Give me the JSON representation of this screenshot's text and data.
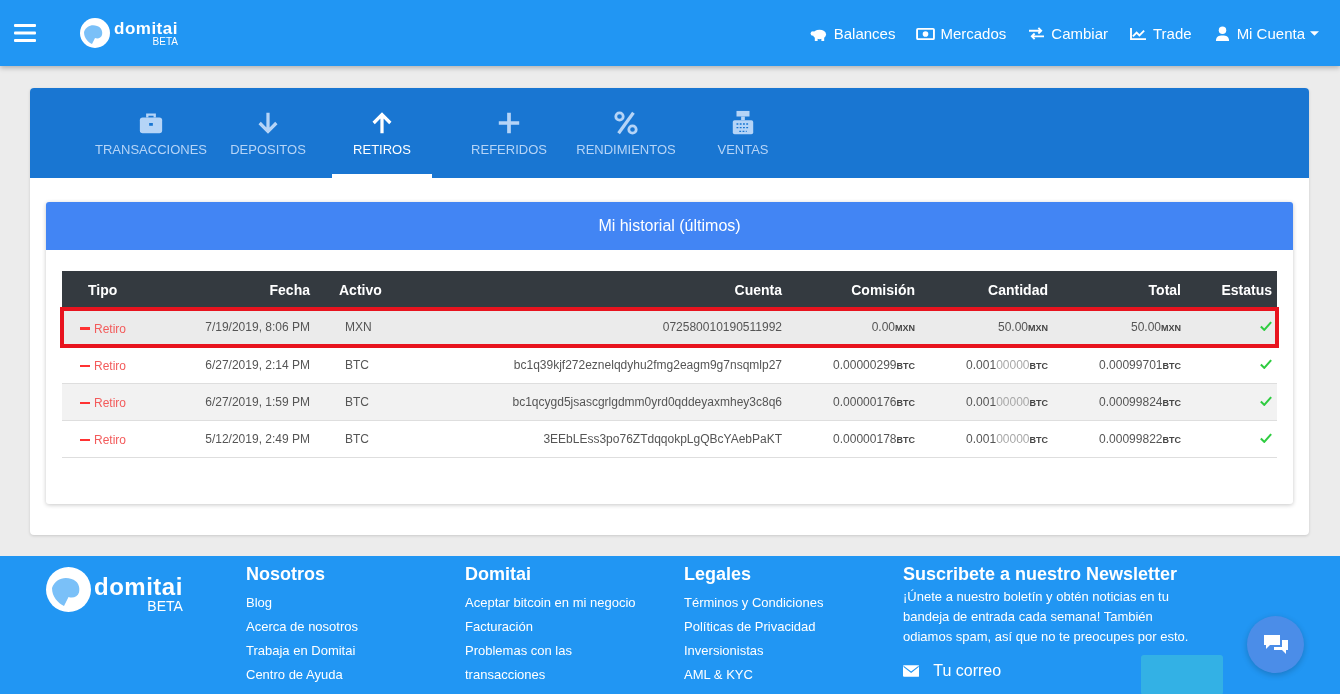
{
  "header": {
    "logo": {
      "name": "domitai",
      "tag": "BETA"
    },
    "nav": [
      {
        "label": "Balances",
        "dropdown": false
      },
      {
        "label": "Mercados",
        "dropdown": false
      },
      {
        "label": "Cambiar",
        "dropdown": false
      },
      {
        "label": "Trade",
        "dropdown": false
      },
      {
        "label": "Mi Cuenta",
        "dropdown": true
      }
    ]
  },
  "tabs": [
    {
      "label": "TRANSACCIONES",
      "selected": false
    },
    {
      "label": "DEPOSITOS",
      "selected": false
    },
    {
      "label": "RETIROS",
      "selected": true
    },
    {
      "label": "REFERIDOS",
      "selected": false
    },
    {
      "label": "RENDIMIENTOS",
      "selected": false
    },
    {
      "label": "VENTAS",
      "selected": false
    }
  ],
  "history": {
    "title": "Mi historial (últimos)",
    "columns": [
      "Tipo",
      "Fecha",
      "Activo",
      "Cuenta",
      "Comisión",
      "Cantidad",
      "Total",
      "Estatus"
    ],
    "rows": [
      {
        "highlighted": true,
        "type": "Retiro",
        "date": "7/19/2019, 8:06 PM",
        "asset": "MXN",
        "account": "072580010190511992",
        "commission": {
          "value": "0.00",
          "unit": "MXN"
        },
        "amount": {
          "value": "50.00",
          "unit": "MXN"
        },
        "total": {
          "value": "50.00",
          "unit": "MXN"
        },
        "completed": true
      },
      {
        "highlighted": false,
        "type": "Retiro",
        "date": "6/27/2019, 2:14 PM",
        "asset": "BTC",
        "account": "bc1q39kjf272eznelqdyhu2fmg2eagm9g7nsqmlp27",
        "commission": {
          "value": "0.00000299",
          "unit": "BTC"
        },
        "amount": {
          "value": "0.001",
          "faded": "00000",
          "unit": "BTC"
        },
        "total": {
          "value": "0.00099701",
          "unit": "BTC"
        },
        "completed": true
      },
      {
        "highlighted": false,
        "type": "Retiro",
        "date": "6/27/2019, 1:59 PM",
        "asset": "BTC",
        "account": "bc1qcygd5jsascgrlgdmm0yrd0qddeyaxmhey3c8q6",
        "commission": {
          "value": "0.00000176",
          "unit": "BTC"
        },
        "amount": {
          "value": "0.001",
          "faded": "00000",
          "unit": "BTC"
        },
        "total": {
          "value": "0.00099824",
          "unit": "BTC"
        },
        "completed": true
      },
      {
        "highlighted": false,
        "type": "Retiro",
        "date": "5/12/2019, 2:49 PM",
        "asset": "BTC",
        "account": "3EEbLEss3po76ZTdqqokpLgQBcYAebPaKT",
        "commission": {
          "value": "0.00000178",
          "unit": "BTC"
        },
        "amount": {
          "value": "0.001",
          "faded": "00000",
          "unit": "BTC"
        },
        "total": {
          "value": "0.00099822",
          "unit": "BTC"
        },
        "completed": true
      }
    ]
  },
  "footer": {
    "logo": {
      "name": "domitai",
      "tag": "BETA"
    },
    "columns": [
      {
        "title": "Nosotros",
        "links": [
          "Blog",
          "Acerca de nosotros",
          "Trabaja en Domitai",
          "Centro de Ayuda"
        ]
      },
      {
        "title": "Domitai",
        "links": [
          "Aceptar bitcoin en mi negocio",
          "Facturación",
          "Problemas con las transacciones"
        ]
      },
      {
        "title": "Legales",
        "links": [
          "Términos y Condiciones",
          "Políticas de Privacidad",
          "Inversionistas",
          "AML & KYC"
        ]
      }
    ],
    "newsletter": {
      "title": "Suscribete a nuestro Newsletter",
      "text": "¡Únete a nuestro boletín y obtén noticias en tu bandeja de entrada cada semana! También odiamos spam, así que no te preocupes por esto.",
      "placeholder": "Tu correo"
    }
  }
}
